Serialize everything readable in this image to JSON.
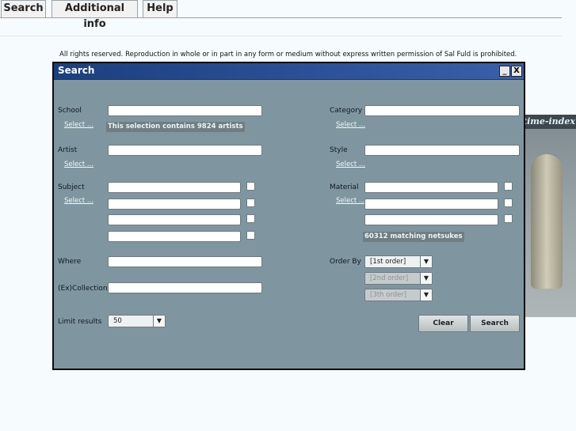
{
  "nav": {
    "tabs": [
      {
        "label": "Search"
      },
      {
        "label": "Additional info"
      },
      {
        "label": "Help"
      }
    ]
  },
  "notice": "All rights reserved. Reproduction in whole or in part in any form or medium without express written permission of Sal Fuld is prohibited.",
  "background_image": {
    "caption": "time-index"
  },
  "dialog": {
    "title": "Search",
    "minimize_label": "_",
    "close_label": "X",
    "select_link": "Select ...",
    "school": {
      "label": "School",
      "value": "",
      "info": "This selection contains 9824 artists"
    },
    "artist": {
      "label": "Artist",
      "value": ""
    },
    "subject": {
      "label": "Subject"
    },
    "where": {
      "label": "Where",
      "value": ""
    },
    "collection": {
      "label": "(Ex)Collection",
      "value": ""
    },
    "limit": {
      "label": "Limit results",
      "value": "50"
    },
    "category": {
      "label": "Category",
      "value": ""
    },
    "style": {
      "label": "Style",
      "value": ""
    },
    "material": {
      "label": "Material",
      "info": "60312 matching netsukes"
    },
    "order_by": {
      "label": "Order By",
      "first": "[1st order]",
      "second": "[2nd order]",
      "third": "[3th order]"
    },
    "clear_label": "Clear",
    "search_label": "Search"
  },
  "colors": {
    "dialog_bg": "#7f96a0",
    "title_bar": "#1b3f7e",
    "page_bg": "#f6fbfd",
    "info_badge": "#6f7e82"
  }
}
